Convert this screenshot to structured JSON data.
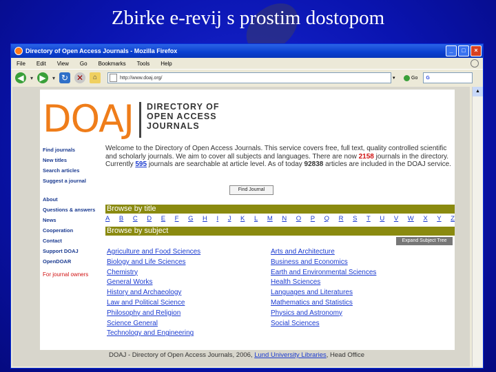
{
  "slide": {
    "title": "Zbirke e-revij s prostim dostopom"
  },
  "browser": {
    "window_title": "Directory of Open Access Journals - Mozilla Firefox",
    "menu": [
      "File",
      "Edit",
      "View",
      "Go",
      "Bookmarks",
      "Tools",
      "Help"
    ],
    "url": "http://www.doaj.org/",
    "go_label": "Go",
    "window_buttons": [
      "_",
      "□",
      "×"
    ]
  },
  "site": {
    "logo": "DOAJ",
    "logo_sub": [
      "DIRECTORY OF",
      "OPEN ACCESS",
      "JOURNALS"
    ],
    "nav_top": [
      "Find journals",
      "New titles",
      "Search articles",
      "Suggest a journal"
    ],
    "nav_bottom": [
      "About",
      "Questions & answers",
      "News",
      "Cooperation",
      "Contact",
      "Support DOAJ",
      "OpenDOAR"
    ],
    "nav_owners": "For journal owners",
    "welcome": {
      "p1": "Welcome to the Directory of Open Access Journals. This service covers free, full text, quality controlled scientific and scholarly journals. We aim to cover all subjects and languages. There are now ",
      "journals": "2158",
      "p2": " journals in the directory. Currently ",
      "searchable": "595",
      "p3": " journals are searchable at article level. As of today ",
      "articles": "92838",
      "p4": " articles are included in the DOAJ service."
    },
    "find_button": "Find Journal",
    "browse_title": "Browse by title",
    "alphabet": [
      "A",
      "B",
      "C",
      "D",
      "E",
      "F",
      "G",
      "H",
      "I",
      "J",
      "K",
      "L",
      "M",
      "N",
      "O",
      "P",
      "Q",
      "R",
      "S",
      "T",
      "U",
      "V",
      "W",
      "X",
      "Y",
      "Z"
    ],
    "browse_subject": "Browse by subject",
    "expand_button": "Expand Subject Tree",
    "subjects_left": [
      "Agriculture and Food Sciences",
      "Biology and Life Sciences",
      "Chemistry",
      "General Works",
      "History and Archaeology",
      "Law and Political Science",
      "Philosophy and Religion",
      "Science General",
      "Technology and Engineering"
    ],
    "subjects_right": [
      "Arts and Architecture",
      "Business and Economics",
      "Earth and Environmental Sciences",
      "Health Sciences",
      "Languages and Literatures",
      "Mathematics and Statistics",
      "Physics and Astronomy",
      "Social Sciences"
    ],
    "footer": {
      "text": "DOAJ - Directory of Open Access Journals, 2006, ",
      "link": "Lund University Libraries",
      "tail": ", Head Office"
    }
  },
  "colors": {
    "accent_orange": "#ef7d1a",
    "bar_olive": "#8a8a10",
    "link_blue": "#1a3ad0",
    "slide_blue": "#0a14b0"
  }
}
